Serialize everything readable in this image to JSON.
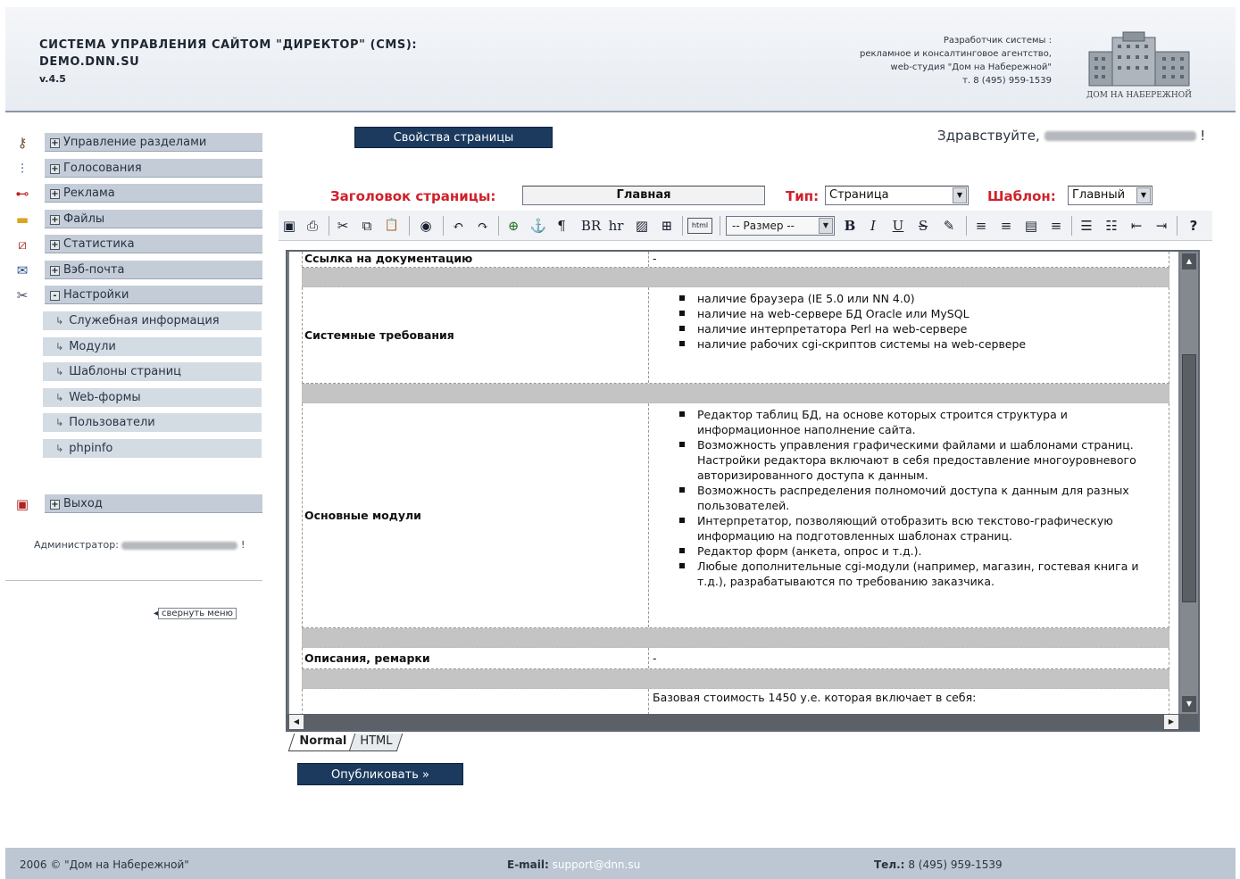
{
  "header": {
    "title_line1": "СИСТЕМА УПРАВЛЕНИЯ САЙТОМ \"ДИРЕКТОР\" (CMS):",
    "title_line2": "DEMO.DNN.SU",
    "version": "v.4.5",
    "dev_line1": "Разработчик системы :",
    "dev_line2": "рекламное и консалтинговое агентство,",
    "dev_line3": "web-студия \"Дом на Набережной\"",
    "dev_line4": "т. 8 (495) 959-1539",
    "logo_text": "ДОМ НА НАБЕРЕЖНОЙ"
  },
  "sidebar": {
    "items": [
      {
        "label": "Управление разделами",
        "toggle": "+",
        "icon": "keys-icon"
      },
      {
        "label": "Голосования",
        "toggle": "+",
        "icon": "poll-icon"
      },
      {
        "label": "Реклама",
        "toggle": "+",
        "icon": "ads-icon"
      },
      {
        "label": "Файлы",
        "toggle": "+",
        "icon": "folder-icon"
      },
      {
        "label": "Статистика",
        "toggle": "+",
        "icon": "chart-icon"
      },
      {
        "label": "Вэб-почта",
        "toggle": "+",
        "icon": "mail-icon"
      },
      {
        "label": "Настройки",
        "toggle": "-",
        "icon": "tools-icon"
      }
    ],
    "subitems": [
      {
        "label": "Служебная информация"
      },
      {
        "label": "Модули"
      },
      {
        "label": "Шаблоны страниц"
      },
      {
        "label": "Web-формы"
      },
      {
        "label": "Пользователи"
      },
      {
        "label": "phpinfo"
      }
    ],
    "exit": {
      "label": "Выход",
      "toggle": "+",
      "icon": "exit-icon"
    },
    "admin_label": "Администратор:",
    "admin_suffix": "!",
    "collapse_label": "свернуть меню",
    "collapse_arrow": "◂"
  },
  "main": {
    "properties_button": "Свойства страницы",
    "greeting": "Здравствуйте,",
    "greeting_suffix": "!",
    "title_label": "Заголовок страницы:",
    "title_value": "Главная",
    "type_label": "Тип:",
    "type_value": "Страница",
    "template_label": "Шаблон:",
    "template_value": "Главный"
  },
  "toolbar": {
    "size_select": "-- Размер --",
    "buttons": [
      {
        "name": "save-icon",
        "glyph": "▣"
      },
      {
        "name": "print-icon",
        "glyph": "⎙"
      },
      {
        "name": "cut-icon",
        "glyph": "✂"
      },
      {
        "name": "copy-icon",
        "glyph": "⧉"
      },
      {
        "name": "paste-icon",
        "glyph": "📋"
      },
      {
        "name": "find-icon",
        "glyph": "◉"
      },
      {
        "name": "undo-icon",
        "glyph": "↶"
      },
      {
        "name": "redo-icon",
        "glyph": "↷"
      },
      {
        "name": "link-icon",
        "glyph": "⊕"
      },
      {
        "name": "anchor-icon",
        "glyph": "⚓"
      },
      {
        "name": "paragraph-icon",
        "glyph": "¶"
      },
      {
        "name": "br-icon",
        "glyph": "BR"
      },
      {
        "name": "hr-icon",
        "glyph": "hr"
      },
      {
        "name": "image-icon",
        "glyph": "▨"
      },
      {
        "name": "table-icon",
        "glyph": "⊞"
      },
      {
        "name": "html-icon",
        "glyph": "html"
      },
      {
        "name": "bold-icon",
        "glyph": "B"
      },
      {
        "name": "italic-icon",
        "glyph": "I"
      },
      {
        "name": "underline-icon",
        "glyph": "U"
      },
      {
        "name": "strike-icon",
        "glyph": "S"
      },
      {
        "name": "color-icon",
        "glyph": "✎"
      },
      {
        "name": "align-left-icon",
        "glyph": "≡"
      },
      {
        "name": "align-center-icon",
        "glyph": "≡"
      },
      {
        "name": "align-justify-icon",
        "glyph": "▤"
      },
      {
        "name": "align-right-icon",
        "glyph": "≡"
      },
      {
        "name": "bullet-list-icon",
        "glyph": "☰"
      },
      {
        "name": "number-list-icon",
        "glyph": "☷"
      },
      {
        "name": "outdent-icon",
        "glyph": "⇤"
      },
      {
        "name": "indent-icon",
        "glyph": "⇥"
      },
      {
        "name": "help-icon",
        "glyph": "?"
      }
    ]
  },
  "document": {
    "rows": [
      {
        "label": "Ссылка на документацию",
        "value": "-"
      },
      {
        "label": "Системные требования",
        "items": [
          "наличие браузера (IE 5.0 или NN 4.0)",
          "наличие на web-сервере БД Oracle или MySQL",
          "наличие интерпретатора Perl на web-сервере",
          "наличие рабочих cgi-скриптов системы на web-сервере"
        ]
      },
      {
        "label": "Основные модули",
        "items": [
          "Редактор таблиц БД, на основе которых строится структура и информационное наполнение сайта.",
          "Возможность управления графическими файлами и шаблонами страниц. Настройки редактора включают в себя предоставление многоуровневого авторизированного доступа к данным.",
          "Возможность распределения полномочий доступа к данным для разных пользователей.",
          "Интерпретатор, позволяющий отобразить всю текстово-графическую информацию на подготовленных шаблонах страниц.",
          "Редактор форм (анкета, опрос и т.д.).",
          "Любые дополнительные cgi-модули (например, магазин, гостевая книга и т.д.), разрабатываются по требованию заказчика."
        ]
      },
      {
        "label": "Описания, ремарки",
        "value": "-"
      },
      {
        "label": "",
        "value": "Базовая стоимость 1450 у.е. которая включает в себя:"
      }
    ]
  },
  "tabs": [
    {
      "label": "Normal",
      "active": true
    },
    {
      "label": "HTML",
      "active": false
    }
  ],
  "publish_button": "Опубликовать »",
  "footer": {
    "copyright": "2006 © \"Дом на Набережной\"",
    "email_label": "E-mail:",
    "email": "support@dnn.su",
    "phone_label": "Тел.:",
    "phone": "8 (495) 959-1539"
  },
  "colors": {
    "accent_red": "#d0212b",
    "button_navy": "#1b3a5e",
    "nav_bg": "#c4cdd7",
    "footer_bg": "#bcc7d3"
  }
}
